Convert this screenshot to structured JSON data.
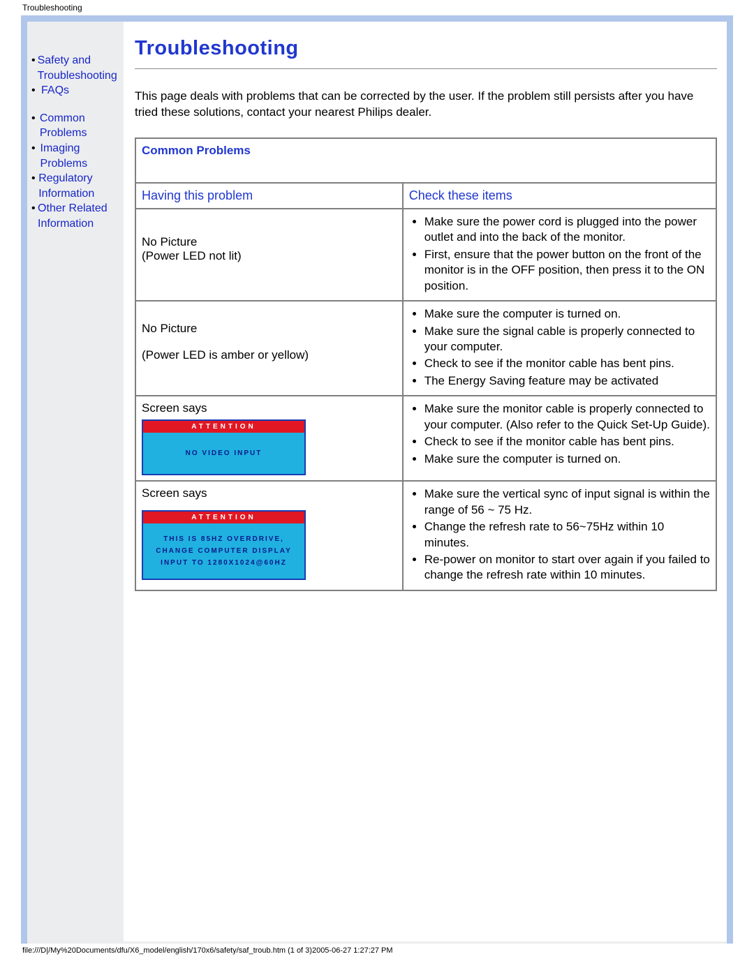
{
  "topTitle": "Troubleshooting",
  "sidebar": {
    "items": [
      {
        "label": "Safety and Troubleshooting"
      },
      {
        "label": "FAQs"
      },
      {
        "label": "Common Problems"
      },
      {
        "label": "Imaging Problems"
      },
      {
        "label": "Regulatory Information"
      },
      {
        "label": "Other Related Information"
      }
    ]
  },
  "heading": "Troubleshooting",
  "intro": "This page deals with problems that can be corrected by the user. If the problem still persists after you have tried these solutions, contact your nearest Philips dealer.",
  "table": {
    "sectionTitle": "Common Problems",
    "colHead": {
      "problem": "Having this problem",
      "check": "Check these items"
    },
    "rows": [
      {
        "problemLine1": "No Picture",
        "problemLine2": "(Power LED not lit)",
        "checks": [
          "Make sure the power cord is plugged into the power outlet and into the back of the monitor.",
          "First, ensure that the power button on the front of the monitor is in the OFF position, then press it to the ON position."
        ]
      },
      {
        "problemLine1": "No Picture",
        "problemLine2": "(Power LED is amber or yellow)",
        "checks": [
          "Make sure the computer is turned on.",
          "Make sure the signal cable is properly connected to your computer.",
          "Check to see if the monitor cable has bent pins.",
          "The Energy Saving feature may be activated"
        ]
      },
      {
        "problemLine1": "Screen says",
        "osd": {
          "head": "ATTENTION",
          "body": "NO VIDEO INPUT"
        },
        "checks": [
          "Make sure the monitor cable is properly connected to your computer. (Also refer to the Quick Set-Up Guide).",
          "Check to see if the monitor cable has bent pins.",
          "Make sure the computer is turned on."
        ]
      },
      {
        "problemLine1": "Screen says",
        "osd": {
          "head": "ATTENTION",
          "bodyLines": [
            "THIS IS 85HZ OVERDRIVE,",
            "CHANGE COMPUTER DISPLAY",
            "INPUT TO 1280X1024@60HZ"
          ]
        },
        "checks": [
          "Make sure the vertical sync of input signal is within the range of 56 ~ 75 Hz.",
          "Change the refresh rate to 56~75Hz within 10 minutes.",
          "Re-power on monitor to start over again if you failed to change the refresh rate within 10 minutes."
        ]
      }
    ]
  },
  "footer": "file:///D|/My%20Documents/dfu/X6_model/english/170x6/safety/saf_troub.htm (1 of 3)2005-06-27 1:27:27 PM"
}
